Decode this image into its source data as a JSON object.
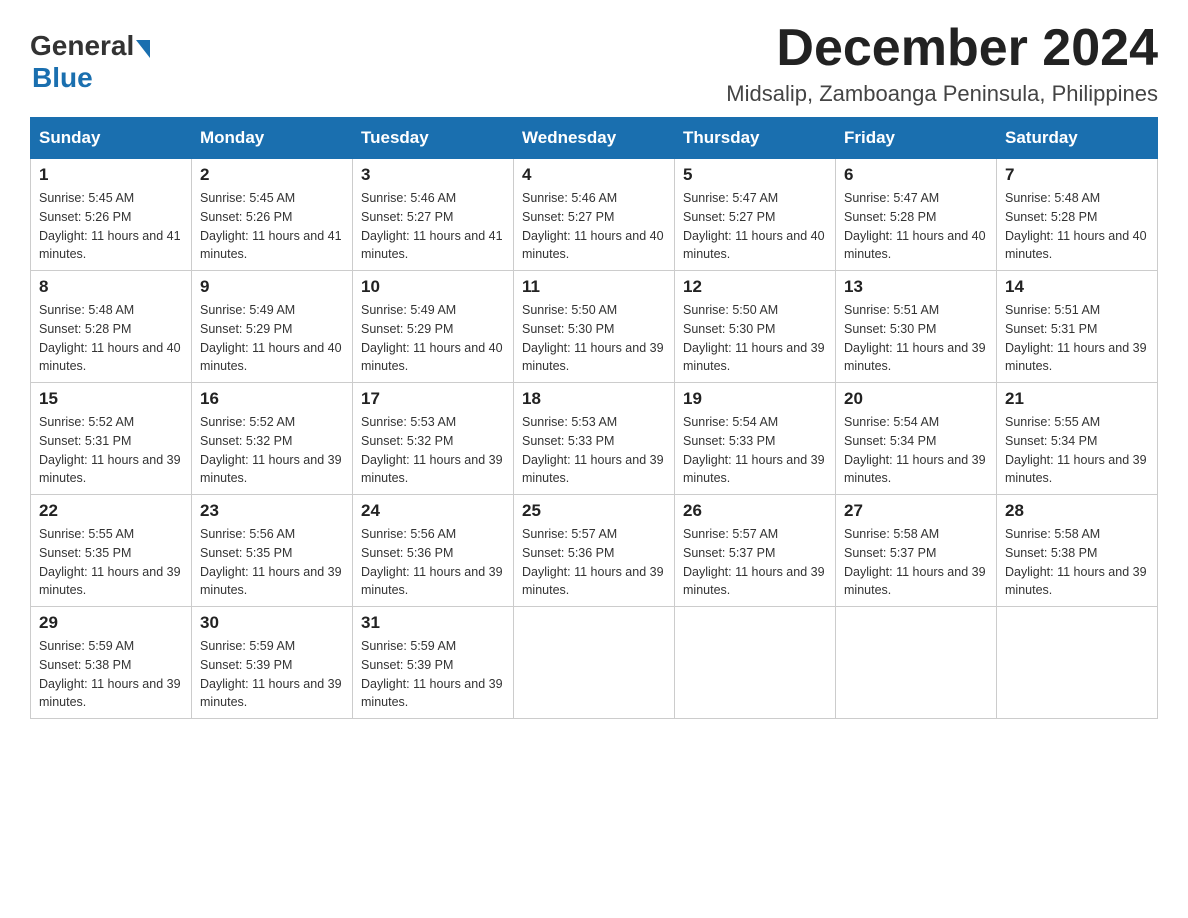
{
  "header": {
    "logo_general": "General",
    "logo_blue": "Blue",
    "month_title": "December 2024",
    "location": "Midsalip, Zamboanga Peninsula, Philippines"
  },
  "weekdays": [
    "Sunday",
    "Monday",
    "Tuesday",
    "Wednesday",
    "Thursday",
    "Friday",
    "Saturday"
  ],
  "weeks": [
    [
      {
        "day": "1",
        "sunrise": "5:45 AM",
        "sunset": "5:26 PM",
        "daylight": "11 hours and 41 minutes."
      },
      {
        "day": "2",
        "sunrise": "5:45 AM",
        "sunset": "5:26 PM",
        "daylight": "11 hours and 41 minutes."
      },
      {
        "day": "3",
        "sunrise": "5:46 AM",
        "sunset": "5:27 PM",
        "daylight": "11 hours and 41 minutes."
      },
      {
        "day": "4",
        "sunrise": "5:46 AM",
        "sunset": "5:27 PM",
        "daylight": "11 hours and 40 minutes."
      },
      {
        "day": "5",
        "sunrise": "5:47 AM",
        "sunset": "5:27 PM",
        "daylight": "11 hours and 40 minutes."
      },
      {
        "day": "6",
        "sunrise": "5:47 AM",
        "sunset": "5:28 PM",
        "daylight": "11 hours and 40 minutes."
      },
      {
        "day": "7",
        "sunrise": "5:48 AM",
        "sunset": "5:28 PM",
        "daylight": "11 hours and 40 minutes."
      }
    ],
    [
      {
        "day": "8",
        "sunrise": "5:48 AM",
        "sunset": "5:28 PM",
        "daylight": "11 hours and 40 minutes."
      },
      {
        "day": "9",
        "sunrise": "5:49 AM",
        "sunset": "5:29 PM",
        "daylight": "11 hours and 40 minutes."
      },
      {
        "day": "10",
        "sunrise": "5:49 AM",
        "sunset": "5:29 PM",
        "daylight": "11 hours and 40 minutes."
      },
      {
        "day": "11",
        "sunrise": "5:50 AM",
        "sunset": "5:30 PM",
        "daylight": "11 hours and 39 minutes."
      },
      {
        "day": "12",
        "sunrise": "5:50 AM",
        "sunset": "5:30 PM",
        "daylight": "11 hours and 39 minutes."
      },
      {
        "day": "13",
        "sunrise": "5:51 AM",
        "sunset": "5:30 PM",
        "daylight": "11 hours and 39 minutes."
      },
      {
        "day": "14",
        "sunrise": "5:51 AM",
        "sunset": "5:31 PM",
        "daylight": "11 hours and 39 minutes."
      }
    ],
    [
      {
        "day": "15",
        "sunrise": "5:52 AM",
        "sunset": "5:31 PM",
        "daylight": "11 hours and 39 minutes."
      },
      {
        "day": "16",
        "sunrise": "5:52 AM",
        "sunset": "5:32 PM",
        "daylight": "11 hours and 39 minutes."
      },
      {
        "day": "17",
        "sunrise": "5:53 AM",
        "sunset": "5:32 PM",
        "daylight": "11 hours and 39 minutes."
      },
      {
        "day": "18",
        "sunrise": "5:53 AM",
        "sunset": "5:33 PM",
        "daylight": "11 hours and 39 minutes."
      },
      {
        "day": "19",
        "sunrise": "5:54 AM",
        "sunset": "5:33 PM",
        "daylight": "11 hours and 39 minutes."
      },
      {
        "day": "20",
        "sunrise": "5:54 AM",
        "sunset": "5:34 PM",
        "daylight": "11 hours and 39 minutes."
      },
      {
        "day": "21",
        "sunrise": "5:55 AM",
        "sunset": "5:34 PM",
        "daylight": "11 hours and 39 minutes."
      }
    ],
    [
      {
        "day": "22",
        "sunrise": "5:55 AM",
        "sunset": "5:35 PM",
        "daylight": "11 hours and 39 minutes."
      },
      {
        "day": "23",
        "sunrise": "5:56 AM",
        "sunset": "5:35 PM",
        "daylight": "11 hours and 39 minutes."
      },
      {
        "day": "24",
        "sunrise": "5:56 AM",
        "sunset": "5:36 PM",
        "daylight": "11 hours and 39 minutes."
      },
      {
        "day": "25",
        "sunrise": "5:57 AM",
        "sunset": "5:36 PM",
        "daylight": "11 hours and 39 minutes."
      },
      {
        "day": "26",
        "sunrise": "5:57 AM",
        "sunset": "5:37 PM",
        "daylight": "11 hours and 39 minutes."
      },
      {
        "day": "27",
        "sunrise": "5:58 AM",
        "sunset": "5:37 PM",
        "daylight": "11 hours and 39 minutes."
      },
      {
        "day": "28",
        "sunrise": "5:58 AM",
        "sunset": "5:38 PM",
        "daylight": "11 hours and 39 minutes."
      }
    ],
    [
      {
        "day": "29",
        "sunrise": "5:59 AM",
        "sunset": "5:38 PM",
        "daylight": "11 hours and 39 minutes."
      },
      {
        "day": "30",
        "sunrise": "5:59 AM",
        "sunset": "5:39 PM",
        "daylight": "11 hours and 39 minutes."
      },
      {
        "day": "31",
        "sunrise": "5:59 AM",
        "sunset": "5:39 PM",
        "daylight": "11 hours and 39 minutes."
      },
      null,
      null,
      null,
      null
    ]
  ],
  "labels": {
    "sunrise": "Sunrise: ",
    "sunset": "Sunset: ",
    "daylight": "Daylight: "
  }
}
